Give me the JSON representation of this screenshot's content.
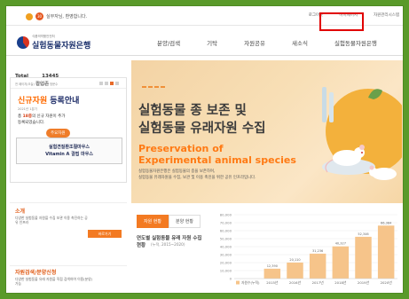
{
  "util": {
    "greeting": "실무자님, 환영합니다.",
    "level_badge": "30",
    "links": [
      "로그아웃",
      "마이페이지",
      "자원관리시스템"
    ]
  },
  "header": {
    "logo_sub": "식품의약품안전처",
    "logo_name": "실험동물자원은행",
    "nav": [
      "분양/검색",
      "기탁",
      "자원공유",
      "새소식",
      "실험동물자원은행"
    ]
  },
  "left": {
    "total_label": "Total",
    "total_count": "13445",
    "total_desc": "전 페이지(오늘) 이전까지의 방문수",
    "popup_title": "팝업존",
    "notice_title_orange": "신규자원",
    "notice_title_navy": " 등록안내",
    "notice_year": "2021년 1분기",
    "notice_line1_pre": "총 ",
    "notice_line1_bold": "18종",
    "notice_line1_post": "의 신규 자원이 추가",
    "notice_line2": "등록되었습니다.",
    "badge": "주요자원",
    "mouse_line1": "실험견질환조절마우스",
    "mouse_line2": "Vitamin A 결핍 마우스",
    "about_title": "소개",
    "about_desc": "다양한 실험동물 자원을 수집 보관 이용 촉진하는 공유 인프라",
    "about_button": "바로가기",
    "search_title": "자원검색/분양신청",
    "search_desc": "다양한 실험동물 유래 자원을 직접 검색하여 이용(분양) 가능"
  },
  "hero": {
    "title_line1": "실험동물 종 보존 및",
    "title_line2": "실험동물 유래자원 수집",
    "eng_line1": "Preservation of",
    "eng_line2": "Experimental animal species",
    "desc_line1": "실험동물자원은행은 실험동물의 종을 보존하며,",
    "desc_line2": "실험동물 유래자원을 수집, 보관 및 이용 촉진을 위한 공유 인프라입니다."
  },
  "stats": {
    "tabs": [
      "자원 현황",
      "분양 현황"
    ],
    "chart_title": "연도별 실험동물 유래 자원 수집 현황",
    "chart_subtitle": "(누적, 2015~2020)"
  },
  "chart_data": {
    "type": "bar",
    "categories": [
      "2015년",
      "2016년",
      "2017년",
      "2018년",
      "2019년",
      "2020년"
    ],
    "values": [
      12390,
      20110,
      31236,
      40327,
      52346,
      66384
    ],
    "value_labels": [
      "12,390",
      "20,110",
      "31,236",
      "40,327",
      "52,346",
      "66,384"
    ],
    "ylim": [
      0,
      80000
    ],
    "yticks": [
      "80,000",
      "70,000",
      "60,000",
      "50,000",
      "40,000",
      "30,000",
      "20,000",
      "10,000",
      "0"
    ],
    "legend": "자원수(누적)",
    "grid": true,
    "bar_color": "#f6c48a"
  }
}
